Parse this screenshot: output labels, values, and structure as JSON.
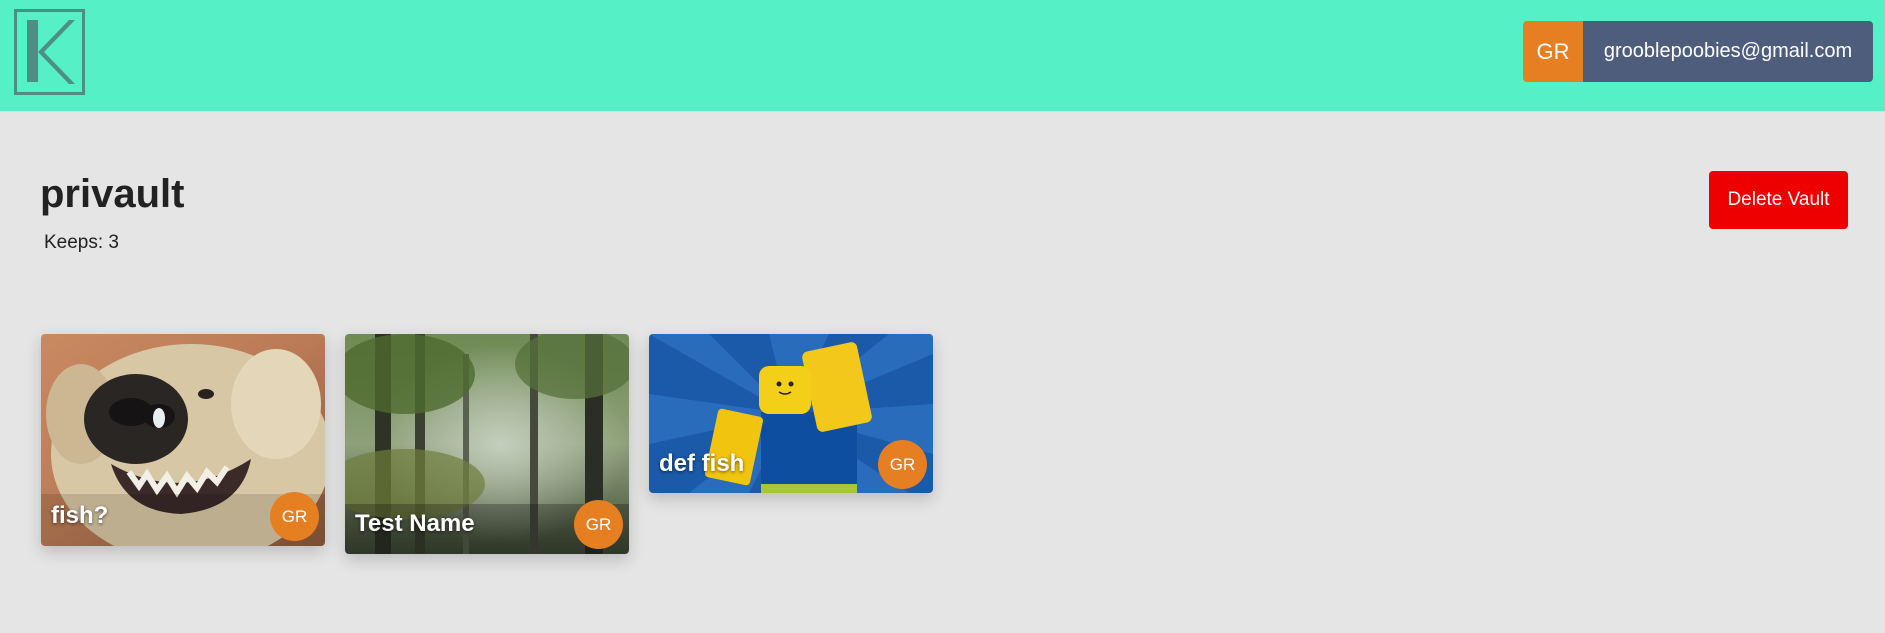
{
  "header": {
    "logo_letter": "K",
    "account_initials": "GR",
    "account_email": "grooblepoobies@gmail.com"
  },
  "vault": {
    "name": "privault",
    "keeps_label": "Keeps: 3",
    "delete_label": "Delete Vault"
  },
  "keeps": [
    {
      "name": "fish?",
      "creator_initials": "GR",
      "image": "smiling dog photo"
    },
    {
      "name": "Test Name",
      "creator_initials": "GR",
      "image": "forest photo"
    },
    {
      "name": "def fish",
      "creator_initials": "GR",
      "image": "blocky character on blue burst"
    }
  ],
  "colors": {
    "navbar": "#56f0c6",
    "background": "#e5e5e5",
    "accent_orange": "#e67e22",
    "email_bg": "#4e5d7b",
    "delete_red": "#ee0000"
  }
}
